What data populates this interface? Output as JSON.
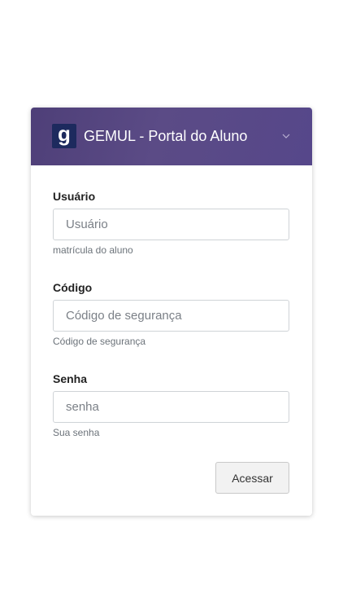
{
  "header": {
    "title": "GEMUL - Portal do Aluno",
    "logo_letter": "g",
    "logo_color": "#1d2a5e",
    "gradient_colors": [
      "#4e3f78",
      "#56478a"
    ]
  },
  "form": {
    "usuario": {
      "label": "Usuário",
      "placeholder": "Usuário",
      "value": "",
      "help": "matrícula do aluno"
    },
    "codigo": {
      "label": "Código",
      "placeholder": "Código de segurança",
      "value": "",
      "help": "Código de segurança"
    },
    "senha": {
      "label": "Senha",
      "placeholder": "senha",
      "value": "",
      "help": "Sua senha"
    },
    "submit_label": "Acessar"
  }
}
